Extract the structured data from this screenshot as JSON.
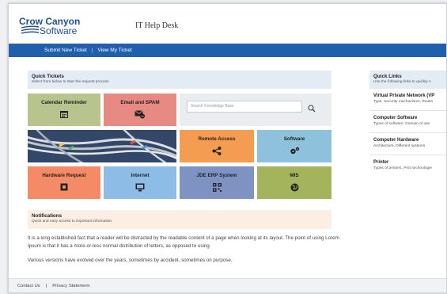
{
  "header": {
    "logo_line1": "Crow Canyon",
    "logo_line2": "Software",
    "app_title": "IT Help Desk"
  },
  "nav": {
    "submit": "Submit New Ticket",
    "separator": "|",
    "view": "View My Ticket"
  },
  "quick_tickets": {
    "title": "Quick Tickets",
    "subtitle": "Select from below to start the request process"
  },
  "tiles": {
    "calendar": "Calendar Reminder",
    "email": "Email and SPAM",
    "remote": "Remote Access",
    "software": "Software",
    "hardware": "Hardware Request",
    "internet": "Internet",
    "jde": "JDE ERP System",
    "mis": "MIS"
  },
  "search": {
    "placeholder": "Search Knowledge Base"
  },
  "notifications": {
    "title": "Notifications",
    "subtitle": "Quick and easy access to important information"
  },
  "body_text": {
    "p1": "It is a long established fact that a reader will be distracted by the readable content of a page when looking at its layout. The point of using Lorem Ipsum is that it has a more-or-less normal distribution of letters, as opposed to using.",
    "p2": "Various versions have evolved over the years, sometimes by accident, sometimes on purpose."
  },
  "footer": {
    "contact": "Contact Us",
    "separator": "|",
    "privacy": "Privacy Statement"
  },
  "quick_links": {
    "title": "Quick Links",
    "subtitle": "Use the following links to quickly n",
    "items": [
      {
        "title": "Virtual Private Network (VP",
        "desc": "Type, Security mechanisms, Routin"
      },
      {
        "title": "Computer Software",
        "desc": "Types of software, Domain of use"
      },
      {
        "title": "Computer Hardware",
        "desc": "Architecture, Different systems"
      },
      {
        "title": "Printer",
        "desc": "Types of printers, Print technologie"
      }
    ]
  },
  "colors": {
    "nav_bar": "#1f5fad",
    "tile_green": "#b7c48d",
    "tile_red": "#e88a84",
    "tile_orange": "#f49d52",
    "tile_blue": "#8ec2dc",
    "tile_salmon": "#f58a66",
    "tile_lightblue": "#8dbde6",
    "tile_slate": "#7f93c3",
    "tile_olive": "#a3b45c"
  },
  "icons": [
    "calendar-icon",
    "email-spam-icon",
    "search-icon",
    "share-icon",
    "gears-icon",
    "hardware-icon",
    "monitor-icon",
    "qr-icon",
    "globe-icon"
  ]
}
